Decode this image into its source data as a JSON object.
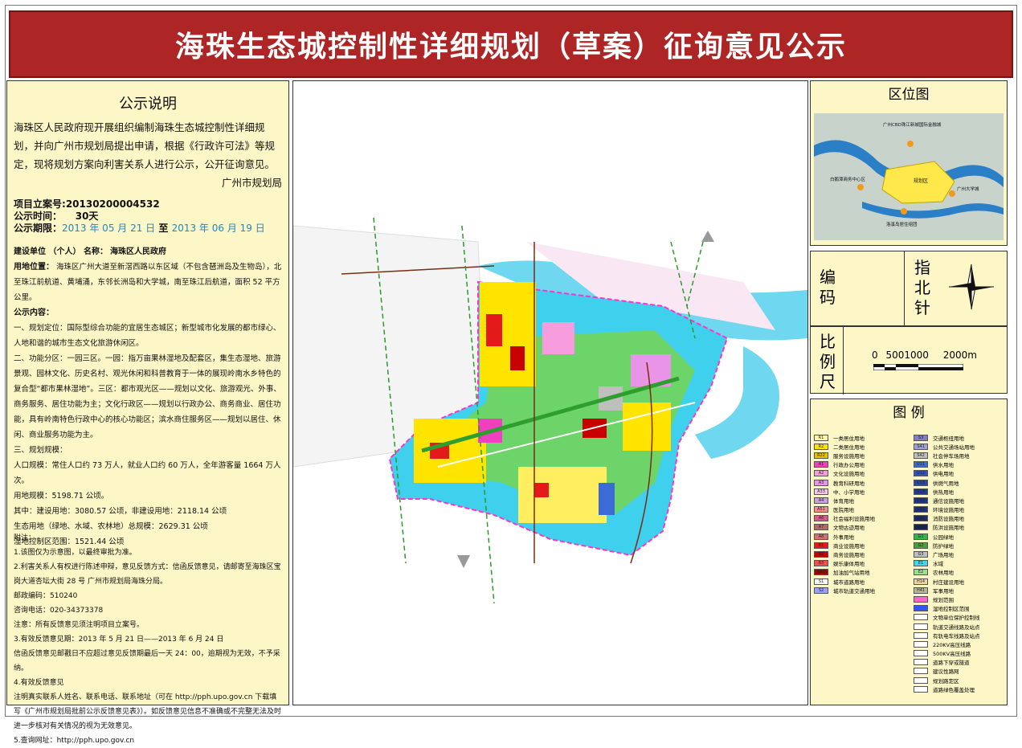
{
  "title": "海珠生态城控制性详细规划（草案）征询意见公示",
  "notice": {
    "heading": "公示说明",
    "intro": "海珠区人民政府现开展组织编制海珠生态城控制性详细规划，并向广州市规划局提出申请，根据《行政许可法》等规定，现将规划方案向利害关系人进行公示，公开征询意见。",
    "signature": "广州市规划局",
    "project_no_label": "项目立案号:",
    "project_no": "20130200004532",
    "period_label": "公示时间：",
    "period": "30天",
    "dates_label": "公示期限：",
    "date_start": "2013 年 05 月 21 日",
    "date_to": "至",
    "date_end": "2013 年 06 月 19 日",
    "builder_label": "建设单位 （个人）  名称：",
    "builder": "海珠区人民政府",
    "site_label": "用地位置：",
    "site": "海珠区广州大道至新滘西路以东区域（不包含琶洲岛及生物岛），北至珠江前航道、黄埔涌，东邻长洲岛和大学城，南至珠江后航道，面积 52 平方公里。",
    "content_label": "公示内容：",
    "sections": [
      "一、规划定位：国际型综合功能的宜居生态城区；新型城市化发展的都市绿心、人地和谐的城市生态文化旅游休闲区。",
      "二、功能分区：一园三区。一园：指万亩果林湿地及配套区，集生态湿地、旅游景观、园林文化、历史名村、观光休闲和科普教育于一体的展现岭南水乡特色的复合型“都市果林湿地”。三区：都市观光区——规划以文化、旅游观光、外事、商务服务、居住功能为主；文化行政区——规划以行政办公、商务商业、居住功能，具有岭南特色行政中心的核心功能区；滨水商住服务区——规划以居住、休闲、商业服务功能为主。",
      "三、规划规模：",
      "人口规模：常住人口约 73 万人，就业人口约 60 万人，全年游客量 1664 万人次。",
      "用地规模：5198.71 公顷。",
      "其中：建设用地：3080.57 公顷，非建设用地：2118.14 公顷",
      "生态用地（绿地、水域、农林地）总规模：2629.31 公顷",
      "湿地控制区范围：1521.44 公顷"
    ],
    "notes": [
      "附注：",
      "1.该图仅为示意图，以最终审批为准。",
      "2.利害关系人有权进行陈述申辩，意见反馈方式：信函反馈意见，请邮寄至海珠区宝岗大道杏坛大街 28 号 广州市规划局海珠分局。",
      "邮政编码：510240",
      "咨询电话：020-34373378",
      "注意：所有反馈意见须注明项目立案号。",
      "3.有效反馈意见期：2013 年 5 月 21 日——2013 年 6 月 24 日",
      "信函反馈意见邮戳日不应超过意见反馈期最后一天 24：00，逾期视为无效，不予采纳。",
      "4.有效反馈意见",
      "注明真实联系人姓名、联系电话、联系地址（可在 http://pph.upo.gov.cn 下载填写《广州市规划局批前公示反馈意见表》）。如反馈意见信息不准确或不完整无法及时进一步核对有关情况的视为无效意见。",
      "5.查询网址：http://pph.upo.gov.cn"
    ]
  },
  "location_map": {
    "title": "区位图",
    "labels": [
      "广州CBD珠江新城国际金融城",
      "规划区",
      "白鹅潭商务中心区",
      "广州大学城",
      "洛溪岛居住组团"
    ]
  },
  "code_label": "编码",
  "north_label": "指北针",
  "scale": {
    "label": "比例尺",
    "ticks": [
      "0",
      "500",
      "1000",
      "2000m"
    ]
  },
  "legend": {
    "title": "图    例",
    "left": [
      {
        "code": "R1",
        "name": "一类居住用地",
        "color": "#fff9a8"
      },
      {
        "code": "R2",
        "name": "二类居住用地",
        "color": "#ffe400"
      },
      {
        "code": "R22",
        "name": "服务设施用地",
        "color": "#e8c000"
      },
      {
        "code": "A1",
        "name": "行政办公用地",
        "color": "#f03fbf"
      },
      {
        "code": "A2",
        "name": "文化设施用地",
        "color": "#f79cdc"
      },
      {
        "code": "A3",
        "name": "教育科研用地",
        "color": "#e994e6"
      },
      {
        "code": "A33",
        "name": "中、小学用地",
        "color": "#f9c8ef"
      },
      {
        "code": "A4",
        "name": "体育用地",
        "color": "#c8a0e0"
      },
      {
        "code": "A51",
        "name": "医院用地",
        "color": "#ff8c8c"
      },
      {
        "code": "A6",
        "name": "社会福利设施用地",
        "color": "#d85a8a"
      },
      {
        "code": "A7",
        "name": "文物古迹用地",
        "color": "#b06a6a"
      },
      {
        "code": "A8",
        "name": "外事用地",
        "color": "#d86f6f"
      },
      {
        "code": "B1",
        "name": "商业设施用地",
        "color": "#e41a1a"
      },
      {
        "code": "B2",
        "name": "商务设施用地",
        "color": "#c80000"
      },
      {
        "code": "B3",
        "name": "娱乐康体用地",
        "color": "#f05050"
      },
      {
        "code": "B41",
        "name": "加油加气站用地",
        "color": "#a00000"
      },
      {
        "code": "S1",
        "name": "城市道路用地",
        "color": "#ffffff"
      },
      {
        "code": "S2",
        "name": "城市轨道交通用地",
        "color": "#9aa0ff"
      }
    ],
    "right": [
      {
        "code": "S3",
        "name": "交通枢纽用地",
        "color": "#8080c0"
      },
      {
        "code": "S41",
        "name": "公共交通场站用地",
        "color": "#a0a0d8"
      },
      {
        "code": "S42",
        "name": "社会停车场用地",
        "color": "#c0c0c0"
      },
      {
        "code": "U11",
        "name": "供水用地",
        "color": "#3b6bd6"
      },
      {
        "code": "U12",
        "name": "供电用地",
        "color": "#3055b5"
      },
      {
        "code": "U13",
        "name": "供燃气用地",
        "color": "#2a4aa0"
      },
      {
        "code": "U14",
        "name": "供热用地",
        "color": "#203c90"
      },
      {
        "code": "U15",
        "name": "通信设施用地",
        "color": "#1f3580"
      },
      {
        "code": "U21",
        "name": "环境设施用地",
        "color": "#20307a"
      },
      {
        "code": "U31",
        "name": "消防设施用地",
        "color": "#1a2a6a"
      },
      {
        "code": "U32",
        "name": "防洪设施用地",
        "color": "#15235a"
      },
      {
        "code": "G1",
        "name": "公园绿地",
        "color": "#2fb84a"
      },
      {
        "code": "G2",
        "name": "防护绿地",
        "color": "#4aa040"
      },
      {
        "code": "G3",
        "name": "广场用地",
        "color": "#bfbfbf"
      },
      {
        "code": "E1",
        "name": "水域",
        "color": "#45d3ef"
      },
      {
        "code": "E2",
        "name": "农林用地",
        "color": "#9be08a"
      },
      {
        "code": "H14",
        "name": "村庄建设用地",
        "color": "#f0d8a0"
      },
      {
        "code": "H41",
        "name": "军事用地",
        "color": "#b8b8a0"
      },
      {
        "code": "",
        "name": "规划范围",
        "color": "#ff66cc"
      },
      {
        "code": "",
        "name": "湿地控制区范围",
        "color": "#3355ff"
      },
      {
        "code": "",
        "name": "文物单位保护控制线",
        "color": "#ffffff"
      },
      {
        "code": "",
        "name": "轨道交通线路及站点",
        "color": "#ffffff"
      },
      {
        "code": "",
        "name": "有轨电车线路及站点",
        "color": "#ffffff"
      },
      {
        "code": "",
        "name": "220KV高压线路",
        "color": "#ffffff"
      },
      {
        "code": "",
        "name": "500KV高压线路",
        "color": "#ffffff"
      },
      {
        "code": "",
        "name": "道路下穿或隧道",
        "color": "#ffffff"
      },
      {
        "code": "",
        "name": "建议性路网",
        "color": "#ffffff"
      },
      {
        "code": "",
        "name": "规划路定区",
        "color": "#ffffff"
      },
      {
        "code": "",
        "name": "道路绿色覆盖处理",
        "color": "#ffffff"
      }
    ]
  }
}
